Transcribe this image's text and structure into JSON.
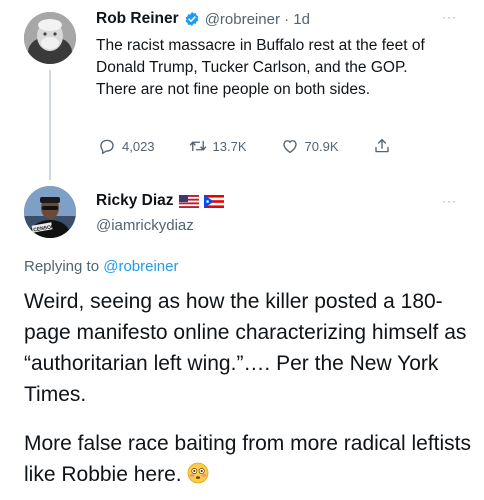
{
  "tweet1": {
    "name": "Rob Reiner",
    "handle_time": "@robreiner · 1d",
    "text": "The racist massacre in Buffalo rest at the feet of Donald Trump, Tucker Carlson, and the GOP. There are not fine people on both sides.",
    "replies": "4,023",
    "retweets": "13.7K",
    "likes": "70.9K",
    "more": "···"
  },
  "tweet2": {
    "name": "Ricky Diaz",
    "handle": "@iamrickydiaz",
    "more": "···",
    "replying_prefix": "Replying to",
    "replying_handle": "@robreiner",
    "paragraph1": "Weird, seeing as how the killer posted a 180-page manifesto online characterizing himself as “authoritarian left wing.”…. Per the New York Times.",
    "paragraph2": "More false race baiting from more radical leftists like Robbie here.",
    "emoji": "😳",
    "shirt_text": "CENSORED"
  },
  "colors": {
    "verified": "#1d9bf0",
    "link": "#1d9bf0",
    "muted": "#536471",
    "text": "#0f1419"
  },
  "icons": [
    "verified-badge-icon",
    "reply-icon",
    "retweet-icon",
    "like-icon",
    "share-icon",
    "us-flag-icon",
    "puerto-rico-flag-icon",
    "flushed-face-icon"
  ]
}
